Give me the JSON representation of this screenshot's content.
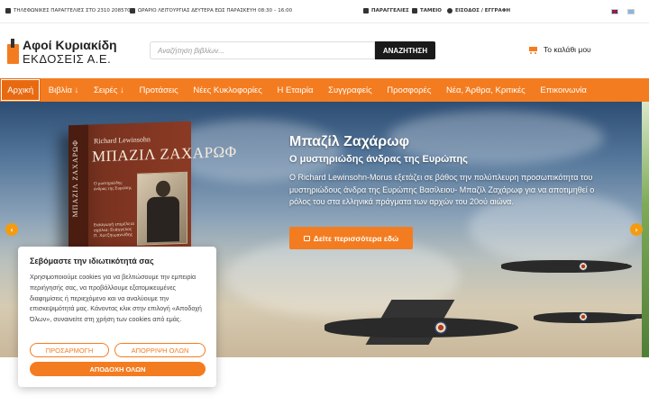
{
  "topbar": {
    "phone": "ΤΗΛΕΦΩΝΙΚΕΣ ΠΑΡΑΓΓΕΛΙΕΣ ΣΤΟ 2310 208570",
    "hours": "ΩΡΑΡΙΟ ΛΕΙΤΟΥΡΓΙΑΣ ΔΕΥΤΕΡΑ ΕΩΣ ΠΑΡΑΣΚΕΥΗ 08:30 – 16:00",
    "orders": "ΠΑΡΑΓΓΕΛΙΕΣ",
    "cashier": "ΤΑΜΕΙΟ",
    "login": "ΕΙΣΟΔΟΣ / ΕΓΓΡΑΦΗ"
  },
  "header": {
    "logo_line1": "Αφοί Κυριακίδη",
    "logo_line2": "ΕΚΔΟΣΕΙΣ Α.Ε.",
    "search_placeholder": "Αναζήτηση βιβλίων...",
    "search_button": "ΑΝΑΖΗΤΗΣΗ",
    "cart_label": "Το καλάθι μου"
  },
  "nav": {
    "items": [
      {
        "label": "Αρχική",
        "active": true
      },
      {
        "label": "Βιβλία ↓"
      },
      {
        "label": "Σειρές ↓"
      },
      {
        "label": "Προτάσεις"
      },
      {
        "label": "Νέες Κυκλοφορίες"
      },
      {
        "label": "Η Εταιρία"
      },
      {
        "label": "Συγγραφείς"
      },
      {
        "label": "Προσφορές"
      },
      {
        "label": "Νέα, Άρθρα, Κριτικές"
      },
      {
        "label": "Επικοινωνία"
      }
    ]
  },
  "hero": {
    "title": "Μπαζίλ Ζαχάρωφ",
    "subtitle": "Ο μυστηριώδης άνδρας της Ευρώπης",
    "body": "Ο Richard Lewinsohn-Morus εξετάζει σε βάθος την πολύπλευρη προσωπικότητα του μυστηριώδους άνδρα της Ευρώπης Βασίλειου- Μπαζίλ Ζαχάρωφ για να αποτιμηθεί ο ρόλος του στα ελληνικά πράγματα των αρχών του 20ού αιώνα.",
    "cta": "Δείτε περισσότερα εδώ",
    "book": {
      "author": "Richard Lewinsohn",
      "title": "ΜΠΑΖΙΛ ΖΑΧΑΡΩΦ",
      "subtitle": "Ο μυστηριώδης άνδρας της Ευρώπης",
      "spine": "ΜΠΑΖΙΛ ΖΑΧΑΡΩΦ",
      "publisher_note": "Εισαγωγή επιμέλεια σχόλια: Ευάγγελος Π. Χατζηιωαννίδης"
    }
  },
  "cookie": {
    "title": "Σεβόμαστε την ιδιωτικότητά σας",
    "text": "Χρησιμοποιούμε cookies για να βελτιώσουμε την εμπειρία περιήγησής σας, να προβάλλουμε εξατομικευμένες διαφημίσεις ή περιεχόμενο και να αναλύουμε την επισκεψιμότητά μας. Κάνοντας κλικ στην επιλογή «Αποδοχή Όλων», συναινείτε στη χρήση των cookies από εμάς.",
    "customize": "ΠΡΟΣΑΡΜΟΓΗ",
    "reject": "ΑΠΟΡΡΙΨΗ ΟΛΩΝ",
    "accept": "ΑΠΟΔΟΧΗ ΟΛΩΝ"
  },
  "colors": {
    "accent": "#f47c20",
    "dark": "#1a1a1a"
  }
}
